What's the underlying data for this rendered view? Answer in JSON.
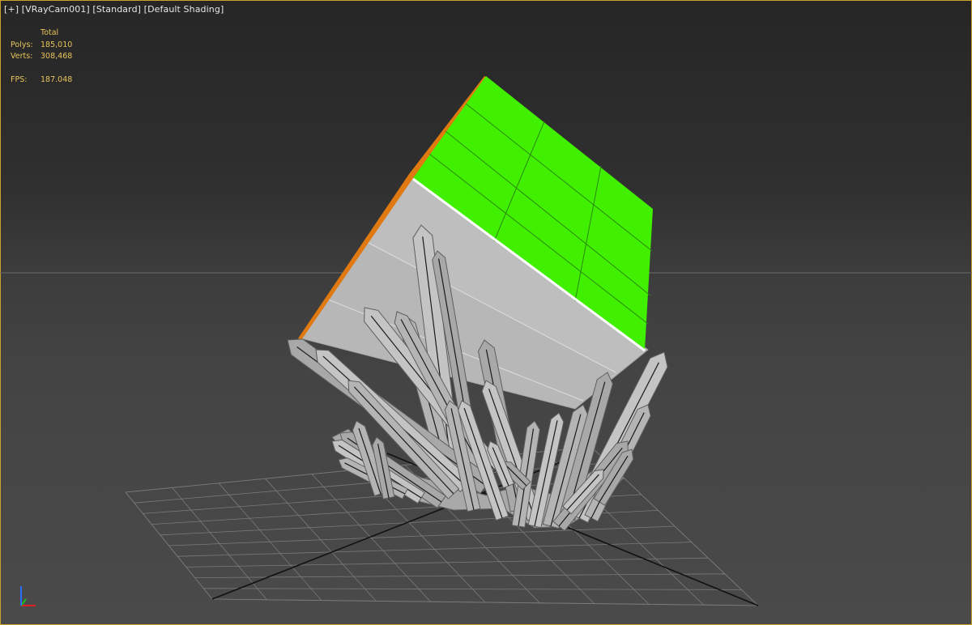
{
  "viewport": {
    "menu_plus": "[+]",
    "camera": "[VRayCam001]",
    "mode": "[Standard]",
    "shading": "[Default Shading]"
  },
  "stats": {
    "header": "Total",
    "polys_label": "Polys:",
    "polys_value": "185,010",
    "verts_label": "Verts:",
    "verts_value": "308,468",
    "fps_label": "FPS:",
    "fps_value": "187.048"
  },
  "colors": {
    "stats_text": "#e8c45a",
    "selected_face": "#40f000",
    "selection_edge": "#e07a10",
    "mesh_gray": "#bdbdbd",
    "viewport_border": "#c9a227",
    "axis_x": "#e02020",
    "axis_y": "#20c020",
    "axis_z": "#2a6dff"
  },
  "icons": {
    "axis_gizmo": "xyz-axis-tripod-icon"
  }
}
